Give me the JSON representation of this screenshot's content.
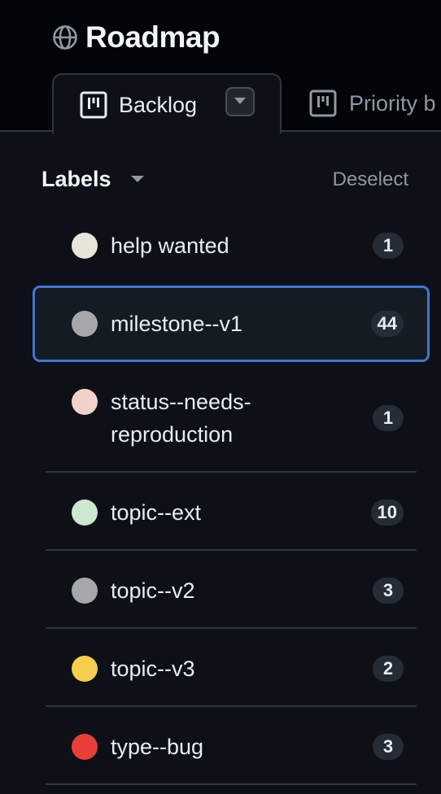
{
  "project": {
    "title": "Roadmap",
    "icon": "globe-icon"
  },
  "tabs": [
    {
      "label": "Backlog",
      "icon": "table-icon",
      "active": true
    },
    {
      "label": "Priority b",
      "icon": "table-icon",
      "active": false
    }
  ],
  "panel": {
    "title": "Labels",
    "deselect_label": "Deselect"
  },
  "labels": [
    {
      "name": "help wanted",
      "count": "1",
      "color": "#e6e6da",
      "selected": false
    },
    {
      "name": "milestone--v1",
      "count": "44",
      "color": "#a7a7a9",
      "selected": true
    },
    {
      "name": "status--needs-reproduction",
      "count": "1",
      "color": "#f2d2c8",
      "selected": false
    },
    {
      "name": "topic--ext",
      "count": "10",
      "color": "#cde8d1",
      "selected": false
    },
    {
      "name": "topic--v2",
      "count": "3",
      "color": "#a7a7a9",
      "selected": false
    },
    {
      "name": "topic--v3",
      "count": "2",
      "color": "#f5cf4d",
      "selected": false
    },
    {
      "name": "type--bug",
      "count": "3",
      "color": "#e83e38",
      "selected": false
    }
  ]
}
